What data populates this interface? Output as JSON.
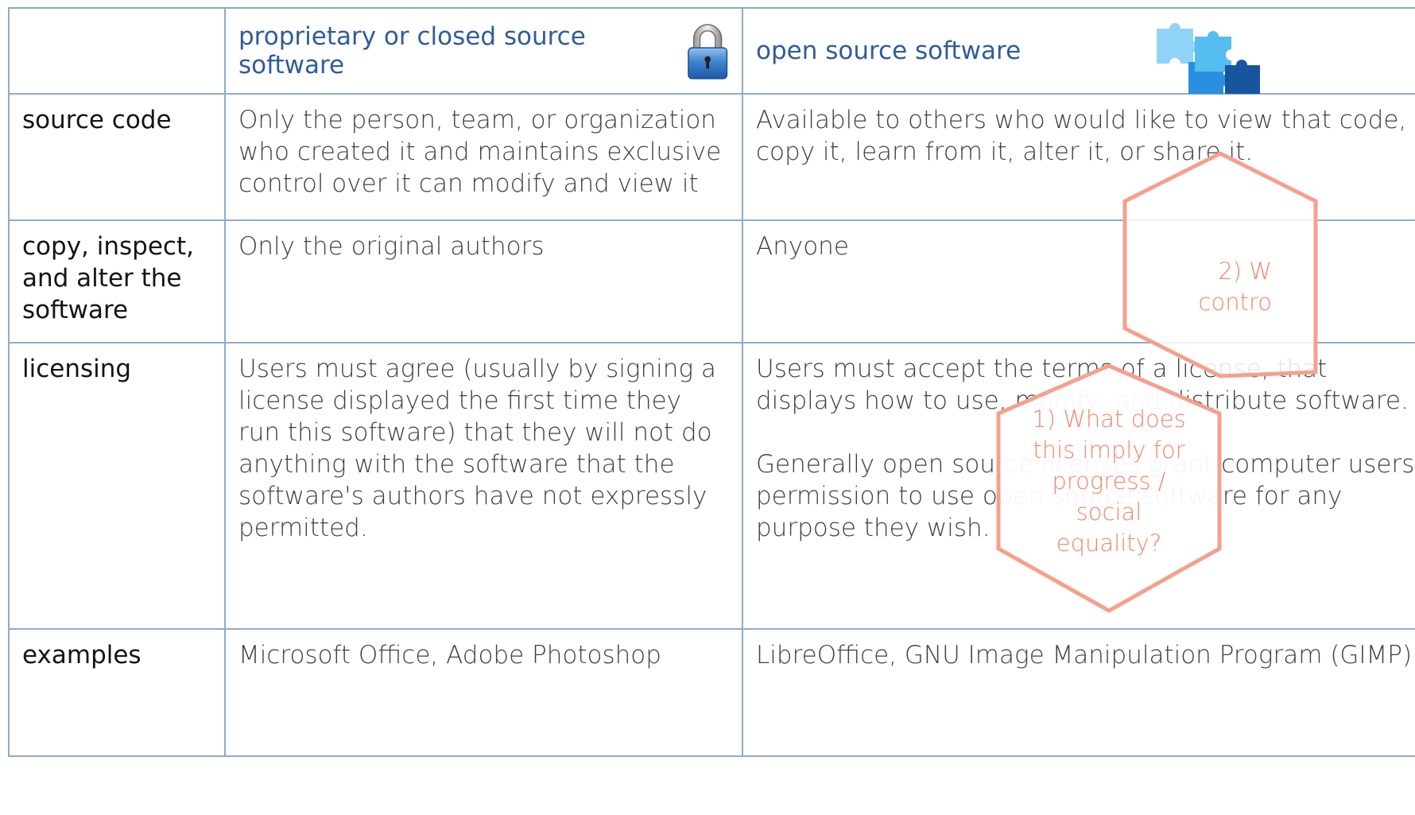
{
  "header": {
    "col1": "",
    "col2": "proprietary or closed source software",
    "col3": "open source software"
  },
  "rows": [
    {
      "label": "source code",
      "proprietary": "Only the person, team, or organization who created it and maintains exclusive control over it can modify and view it",
      "open": "Available to others who would like to view that code, copy it, learn from it, alter it, or share it."
    },
    {
      "label": "copy, inspect, and alter the software",
      "proprietary": "Only the original authors",
      "open": "Anyone"
    },
    {
      "label": "licensing",
      "proprietary": "Users must agree (usually by signing a license displayed the first time they run this software) that they will not do anything with the software that the software's authors have not expressly permitted.",
      "open": "Users must accept the terms of a license, that displays how to use, modify, and distribute software.",
      "open_2": "Generally open source licenses grant computer users permission to use open source software for any purpose they wish."
    },
    {
      "label": "examples",
      "proprietary": "Microsoft Office, Adobe Photoshop",
      "open": "LibreOffice, GNU Image Manipulation Program (GIMP)"
    }
  ],
  "callouts": {
    "q1": "1) What does this imply for progress / social equality?",
    "q2": "2) W contro"
  },
  "colors": {
    "border": "#8faad4",
    "header_text": "#2f5c9c",
    "callout": "#f5856b"
  },
  "icons": {
    "lock": "padlock-icon",
    "puzzle": "puzzle-pieces-icon"
  }
}
